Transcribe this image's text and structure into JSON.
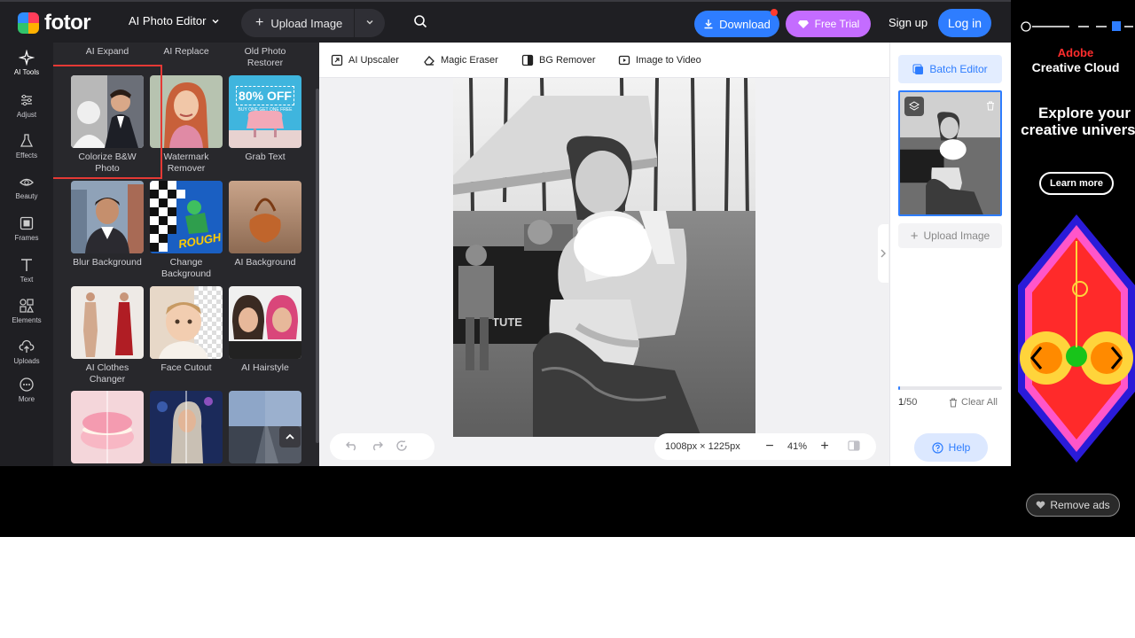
{
  "brand": {
    "name": "fotor"
  },
  "header": {
    "ai_menu": "AI Photo Editor",
    "upload_label": "Upload Image",
    "download_label": "Download",
    "trial_label": "Free Trial",
    "signup_label": "Sign up",
    "login_label": "Log in"
  },
  "leftnav": {
    "items": [
      {
        "label": "AI Tools",
        "icon": "sparkle-icon"
      },
      {
        "label": "Adjust",
        "icon": "sliders-icon"
      },
      {
        "label": "Effects",
        "icon": "flask-icon"
      },
      {
        "label": "Beauty",
        "icon": "eye-icon"
      },
      {
        "label": "Frames",
        "icon": "frame-icon"
      },
      {
        "label": "Text",
        "icon": "text-icon"
      },
      {
        "label": "Elements",
        "icon": "shapes-icon"
      },
      {
        "label": "Uploads",
        "icon": "cloud-upload-icon"
      },
      {
        "label": "More",
        "icon": "more-icon"
      }
    ]
  },
  "panel": {
    "top_labels": [
      "AI Expand",
      "AI Replace",
      "Old Photo Restorer"
    ],
    "tiles": [
      {
        "label": "Colorize B&W Photo"
      },
      {
        "label": "Watermark Remover"
      },
      {
        "label": "Grab Text",
        "badge_main": "80% OFF",
        "badge_sub": "BUY ONE GET ONE FREE"
      },
      {
        "label": "Blur Background"
      },
      {
        "label": "Change Background",
        "art_text": "ROUGH"
      },
      {
        "label": "AI Background"
      },
      {
        "label": "AI Clothes Changer"
      },
      {
        "label": "Face Cutout"
      },
      {
        "label": "AI Hairstyle"
      },
      {
        "label": ""
      },
      {
        "label": ""
      },
      {
        "label": ""
      }
    ]
  },
  "toolbar": {
    "tools": [
      {
        "label": "AI Upscaler",
        "icon": "upscale-icon"
      },
      {
        "label": "Magic Eraser",
        "icon": "eraser-icon"
      },
      {
        "label": "BG Remover",
        "icon": "bg-remover-icon"
      },
      {
        "label": "Image to Video",
        "icon": "video-icon"
      }
    ]
  },
  "canvas": {
    "dimensions": "1008px × 1225px",
    "zoom": "41%",
    "banner_text": "TUTE"
  },
  "rightpanel": {
    "batch_label": "Batch Editor",
    "upload_label": "Upload Image",
    "count_current": "1",
    "count_total": "/50",
    "clear_label": "Clear All",
    "help_label": "Help",
    "progress": 0.02
  },
  "ad": {
    "brand_line1": "Adobe",
    "brand_line2": "Creative Cloud",
    "headline": "Explore your creative universe.",
    "cta": "Learn more",
    "remove_ads": "Remove ads"
  },
  "colors": {
    "accent": "#2e7dff",
    "trial": "#c46cff",
    "highlight": "#e53935",
    "dark_bg": "#1f1f23",
    "panel_bg": "#28282c"
  }
}
